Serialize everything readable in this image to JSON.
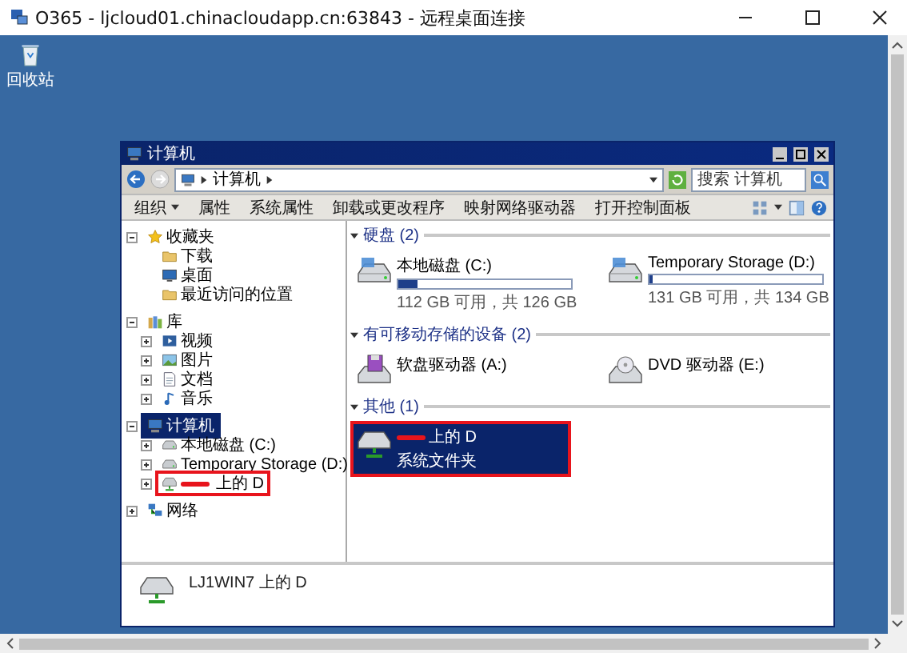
{
  "remote_window": {
    "title": "O365 - ljcloud01.chinacloudapp.cn:63843 - 远程桌面连接"
  },
  "desktop_icons": [
    {
      "label": "回收站"
    }
  ],
  "explorer": {
    "title": "计算机",
    "address": [
      "计算机"
    ],
    "search": {
      "placeholder": "搜索 计算机"
    },
    "toolbar": [
      {
        "label": "组织",
        "menu": true
      },
      {
        "label": "属性",
        "menu": false
      },
      {
        "label": "系统属性",
        "menu": false
      },
      {
        "label": "卸载或更改程序",
        "menu": false
      },
      {
        "label": "映射网络驱动器",
        "menu": false
      },
      {
        "label": "打开控制面板",
        "menu": false
      }
    ],
    "sidebar": [
      {
        "label": "收藏夹",
        "kind": "star",
        "expanded": true,
        "selected": false,
        "children": [
          {
            "label": "下载",
            "kind": "folder",
            "selected": false
          },
          {
            "label": "桌面",
            "kind": "desktop",
            "selected": false
          },
          {
            "label": "最近访问的位置",
            "kind": "folder",
            "selected": false
          }
        ]
      },
      {
        "label": "库",
        "kind": "library",
        "expanded": true,
        "selected": false,
        "children": [
          {
            "label": "视频",
            "kind": "video",
            "expanded": false,
            "selected": false
          },
          {
            "label": "图片",
            "kind": "picture",
            "expanded": false,
            "selected": false
          },
          {
            "label": "文档",
            "kind": "document",
            "expanded": false,
            "selected": false
          },
          {
            "label": "音乐",
            "kind": "music",
            "expanded": false,
            "selected": false
          }
        ]
      },
      {
        "label": "计算机",
        "kind": "computer",
        "expanded": true,
        "selected": true,
        "children": [
          {
            "label": "本地磁盘 (C:)",
            "kind": "disk",
            "expanded": false,
            "selected": false
          },
          {
            "label": "Temporary Storage (D:)",
            "kind": "disk",
            "expanded": false,
            "selected": false
          },
          {
            "label": "上的 D",
            "kind": "netdrive",
            "expanded": false,
            "selected": false,
            "redacted": true,
            "highlighted": true
          }
        ]
      },
      {
        "label": "网络",
        "kind": "network",
        "expanded": false,
        "selected": false
      }
    ],
    "sections": [
      {
        "title": "硬盘 (2)",
        "items": [
          {
            "name": "本地磁盘 (C:)",
            "kind": "disk",
            "level": 0.11,
            "detail": "112 GB 可用，共 126 GB",
            "selected": false
          },
          {
            "name": "Temporary Storage (D:)",
            "kind": "disk",
            "level": 0.02,
            "detail": "131 GB 可用，共 134 GB",
            "selected": false
          }
        ]
      },
      {
        "title": "有可移动存储的设备 (2)",
        "items": [
          {
            "name": "软盘驱动器 (A:)",
            "kind": "floppy",
            "selected": false
          },
          {
            "name": "DVD 驱动器 (E:)",
            "kind": "dvd",
            "selected": false
          }
        ]
      },
      {
        "title": "其他 (1)",
        "items": [
          {
            "name": "上的 D",
            "kind": "netdrive",
            "detail": "系统文件夹",
            "selected": true,
            "redacted": true,
            "highlighted": true
          }
        ]
      }
    ],
    "details": {
      "name": "LJ1WIN7 上的 D"
    }
  }
}
